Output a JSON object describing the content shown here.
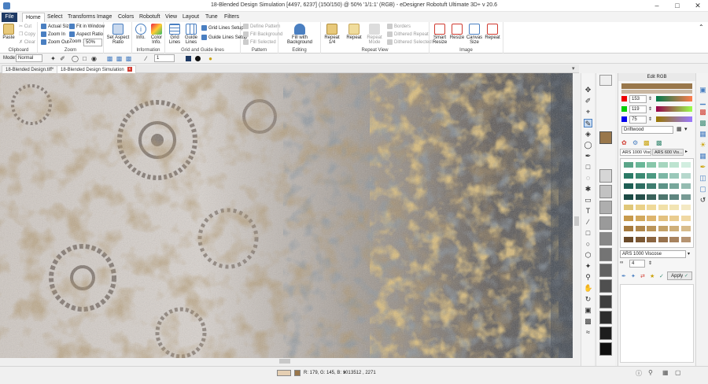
{
  "window": {
    "title": "18-Blended Design Simulation [4497, 6237] (150/150)  @ 50% '1/1:1' (RGB) - eDesigner Robotuft Ultimate 3D+ v 20.6"
  },
  "menu": {
    "file": "File",
    "tabs": [
      "Home",
      "Select",
      "Transforms",
      "Image",
      "Colors",
      "Robotuft",
      "View",
      "Layout",
      "Tune",
      "Filters"
    ]
  },
  "ribbon": {
    "clipboard": {
      "label": "Clipboard",
      "paste": "Paste",
      "cut": "Cut",
      "copy": "Copy",
      "clear": "Clear"
    },
    "zoom": {
      "label": "Zoom",
      "actual_size": "Actual Size",
      "zoom_in": "Zoom In",
      "zoom_out": "Zoom Out",
      "fit_in_window": "Fit in Window",
      "aspect_ratio": "Aspect Ratio",
      "zoom_label": "Zoom :",
      "zoom_value": "50%"
    },
    "set_aspect_ratio": "Set Aspect Ratio",
    "information": {
      "label": "Information",
      "info": "Info.",
      "color_info": "Color Info."
    },
    "grid": {
      "label": "Grid and Guide lines",
      "grid_lines": "Grid Lines",
      "guide_lines": "Guide Lines",
      "grid_lines_setup": "Grid Lines Setup",
      "guide_lines_setup": "Guide Lines Setup"
    },
    "pattern": {
      "label": "Pattern",
      "define_pattern": "Define Pattern",
      "fill_background": "Fill Background",
      "fill_selected": "Fill Selected"
    },
    "editing": {
      "label": "Editing",
      "fill_with_background": "Fill with Background"
    },
    "repeat_view": {
      "label": "Repeat View",
      "repeat_1_4": "Repeat 1/4",
      "repeat": "Repeat",
      "repeat_mode": "Repeat Mode",
      "borders": "Borders",
      "dithered_repeat": "Dithered Repeat",
      "dithered_selected": "Dithered Selected"
    },
    "image": {
      "label": "Image",
      "smart_resize": "Smart Resize",
      "resize": "Resize",
      "canvas_size": "Canvas Size",
      "repeat": "Repeat"
    }
  },
  "options": {
    "mode_label": "Mode:",
    "mode_value": "Normal",
    "size_value": "1"
  },
  "doc_tabs": [
    "18-Blended Design.tiff*",
    "18-Blended Design Simulation"
  ],
  "panel": {
    "title": "Edit RGB",
    "r": "153",
    "g": "119",
    "b": "75",
    "color_name": "Driftwood",
    "palette_tab1": "ARS 1000 Viscose",
    "palette_tab2": "ARS 600 Vis...",
    "palette_name": "ARS 1000 Viscose",
    "num_value": "4",
    "apply": "Apply",
    "current_color": "#99774b"
  },
  "status": {
    "rgb": "R: 179, G: 145, B: 101",
    "coords": "3512 , 2271"
  },
  "palette_colors": [
    [
      "#5aa589",
      "#6ab798",
      "#88c7aa",
      "#a6d6bf",
      "#bde3d0",
      "#d2eee0"
    ],
    [
      "#2a7a66",
      "#3b8a73",
      "#4c9a82",
      "#7cb7a5",
      "#9ac8b9",
      "#b6d8cd"
    ],
    [
      "#1d5e54",
      "#2e6d62",
      "#3f7d70",
      "#5d9387",
      "#78a79b",
      "#95bcb1"
    ],
    [
      "#1b4a45",
      "#264f4a",
      "#3a625b",
      "#4d756d",
      "#5f8680",
      "#789b95"
    ],
    [
      "#e0c779",
      "#ead188",
      "#efd999",
      "#f1e0a8",
      "#f2e4b3",
      "#f4e9c4"
    ],
    [
      "#c79a4c",
      "#d2a85c",
      "#ddb46d",
      "#e3c17f",
      "#e9cc8f",
      "#f0d8a3"
    ],
    [
      "#a67a3d",
      "#b0874b",
      "#ba9459",
      "#c4a268",
      "#ceae78",
      "#d8bc8b"
    ],
    [
      "#6a4a2a",
      "#7b5733",
      "#8a6440",
      "#98724d",
      "#a7825e",
      "#b69472"
    ]
  ],
  "gray_swatches": [
    "#d6d6d6",
    "#c2c2c2",
    "#aeaeae",
    "#9a9a9a",
    "#878787",
    "#747474",
    "#616161",
    "#4f4f4f",
    "#3e3e3e",
    "#2d2d2d",
    "#1d1d1d",
    "#0f0f0f"
  ]
}
